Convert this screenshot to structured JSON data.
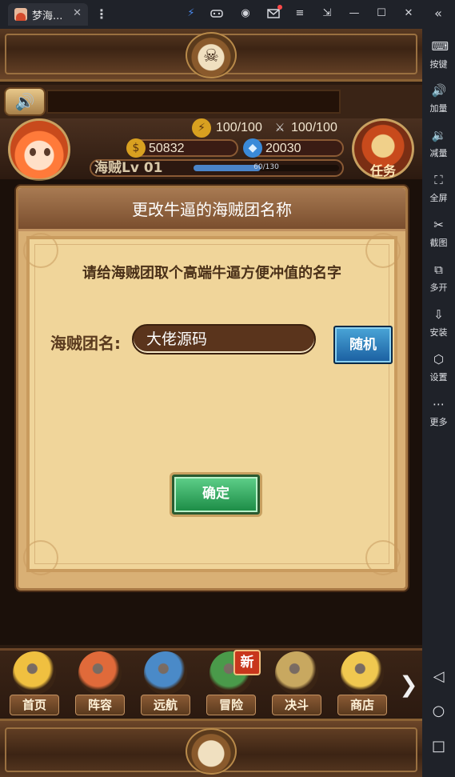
{
  "titlebar": {
    "tab_title": "梦海...",
    "close_glyph": "✕",
    "menu_glyph": "⋮",
    "icons": [
      "boost-icon",
      "gamepad-icon",
      "account-icon",
      "mail-icon",
      "menu-icon",
      "popout-icon",
      "minimize-icon",
      "maximize-icon",
      "close-icon",
      "collapse-icon"
    ],
    "glyphs": {
      "boost": "⚡",
      "gamepad": "🎮",
      "account": "◉",
      "mail": "✉",
      "menu": "≡",
      "popout": "⇲",
      "minimize": "—",
      "maximize": "☐",
      "close": "✕",
      "collapse": "«"
    }
  },
  "sidebar": {
    "items": [
      {
        "label": "按键",
        "glyph": "⌨"
      },
      {
        "label": "加量",
        "glyph": "🔊"
      },
      {
        "label": "减量",
        "glyph": "🔉"
      },
      {
        "label": "全屏",
        "glyph": "⛶"
      },
      {
        "label": "截图",
        "glyph": "✂"
      },
      {
        "label": "多开",
        "glyph": "⧉"
      },
      {
        "label": "安装",
        "glyph": "⇩"
      },
      {
        "label": "设置",
        "glyph": "⬡"
      },
      {
        "label": "更多",
        "glyph": "⋯"
      }
    ],
    "nav": {
      "back": "◁",
      "home": "○",
      "recent": "□"
    }
  },
  "status": {
    "stamina": "100/100",
    "energy": "100/100",
    "coins": "50832",
    "gems": "20030",
    "level_label": "海贼Lv 01",
    "xp_text": "60/130",
    "xp_fraction": 0.4615,
    "task_label": "任务"
  },
  "dialog": {
    "title": "更改牛逼的海贼团名称",
    "prompt": "请给海贼团取个高端牛逼方便冲值的名字",
    "name_label": "海贼团名:",
    "name_value": "大佬源码",
    "random_button": "随机",
    "confirm_button": "确定"
  },
  "bottom_nav": {
    "items": [
      {
        "label": "首页",
        "color": "#f0c040"
      },
      {
        "label": "阵容",
        "color": "#e06a3a"
      },
      {
        "label": "远航",
        "color": "#4a8ac8"
      },
      {
        "label": "冒险",
        "color": "#4a9a4a"
      },
      {
        "label": "决斗",
        "color": "#c8a860"
      },
      {
        "label": "商店",
        "color": "#f0c850"
      }
    ],
    "new_badge": "新",
    "next_glyph": "❯"
  },
  "colors": {
    "titlebar_bg": "#1f2229",
    "dialog_bg": "#d9b075",
    "random_btn": "#1a5ea0",
    "confirm_btn": "#1a8a44"
  }
}
